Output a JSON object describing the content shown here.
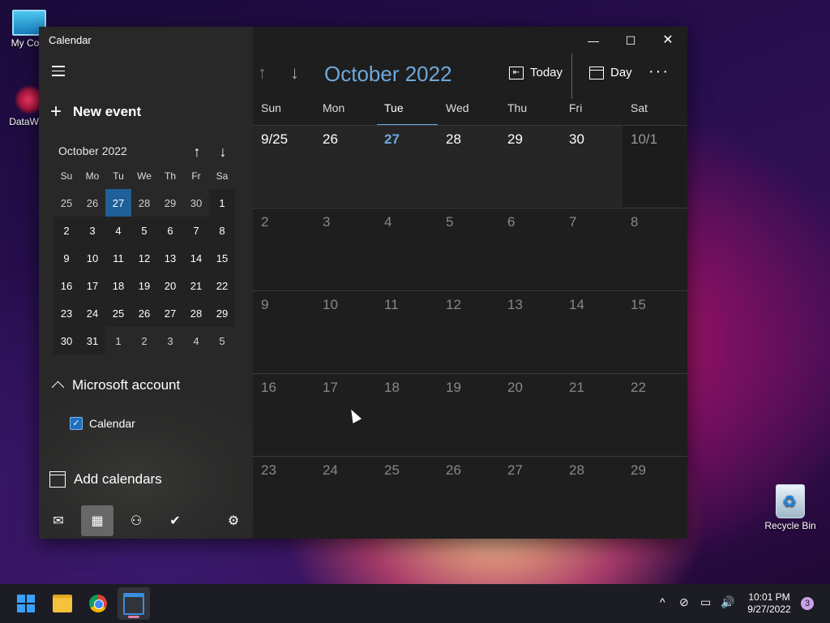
{
  "desktop": {
    "icons": [
      {
        "label": "My Com"
      },
      {
        "label": "DataWag"
      },
      {
        "label": "Recycle Bin"
      }
    ]
  },
  "window": {
    "title": "Calendar",
    "controls": {
      "minimize": "—",
      "maximize": "☐",
      "close": "✕"
    }
  },
  "sidebar": {
    "new_event": "New event",
    "new_event_plus": "+",
    "mini_calendar": {
      "month": "October 2022",
      "up": "↑",
      "down": "↓",
      "weekdays": [
        "Su",
        "Mo",
        "Tu",
        "We",
        "Th",
        "Fr",
        "Sa"
      ],
      "weeks": [
        [
          "25",
          "26",
          "27",
          "28",
          "29",
          "30",
          "1"
        ],
        [
          "2",
          "3",
          "4",
          "5",
          "6",
          "7",
          "8"
        ],
        [
          "9",
          "10",
          "11",
          "12",
          "13",
          "14",
          "15"
        ],
        [
          "16",
          "17",
          "18",
          "19",
          "20",
          "21",
          "22"
        ],
        [
          "23",
          "24",
          "25",
          "26",
          "27",
          "28",
          "29"
        ],
        [
          "30",
          "31",
          "1",
          "2",
          "3",
          "4",
          "5"
        ]
      ]
    },
    "account": "Microsoft account",
    "calendar_item": "Calendar",
    "calendar_checked": "✓",
    "add_calendars": "Add calendars",
    "nav": {
      "mail": "✉",
      "calendar": "▦",
      "people": "⚇",
      "todo": "✔",
      "settings": "⚙"
    }
  },
  "main": {
    "nav_up": "↑",
    "nav_down": "↓",
    "month_title": "October 2022",
    "today_label": "Today",
    "today_icon": "⇤",
    "day_label": "Day",
    "more": "···",
    "weekdays": [
      "Sun",
      "Mon",
      "Tue",
      "Wed",
      "Thu",
      "Fri",
      "Sat"
    ],
    "weeks": [
      [
        "9/25",
        "26",
        "27",
        "28",
        "29",
        "30",
        "10/1"
      ],
      [
        "2",
        "3",
        "4",
        "5",
        "6",
        "7",
        "8"
      ],
      [
        "9",
        "10",
        "11",
        "12",
        "13",
        "14",
        "15"
      ],
      [
        "16",
        "17",
        "18",
        "19",
        "20",
        "21",
        "22"
      ],
      [
        "23",
        "24",
        "25",
        "26",
        "27",
        "28",
        "29"
      ]
    ]
  },
  "taskbar": {
    "tray": {
      "chevron": "^",
      "network": "⊘",
      "display": "▭",
      "volume": "🔊"
    },
    "time": "10:01 PM",
    "date": "9/27/2022",
    "notifications": "3"
  },
  "colors": {
    "accent": "#6fa8dc",
    "today_bg": "#1f5f9a"
  }
}
